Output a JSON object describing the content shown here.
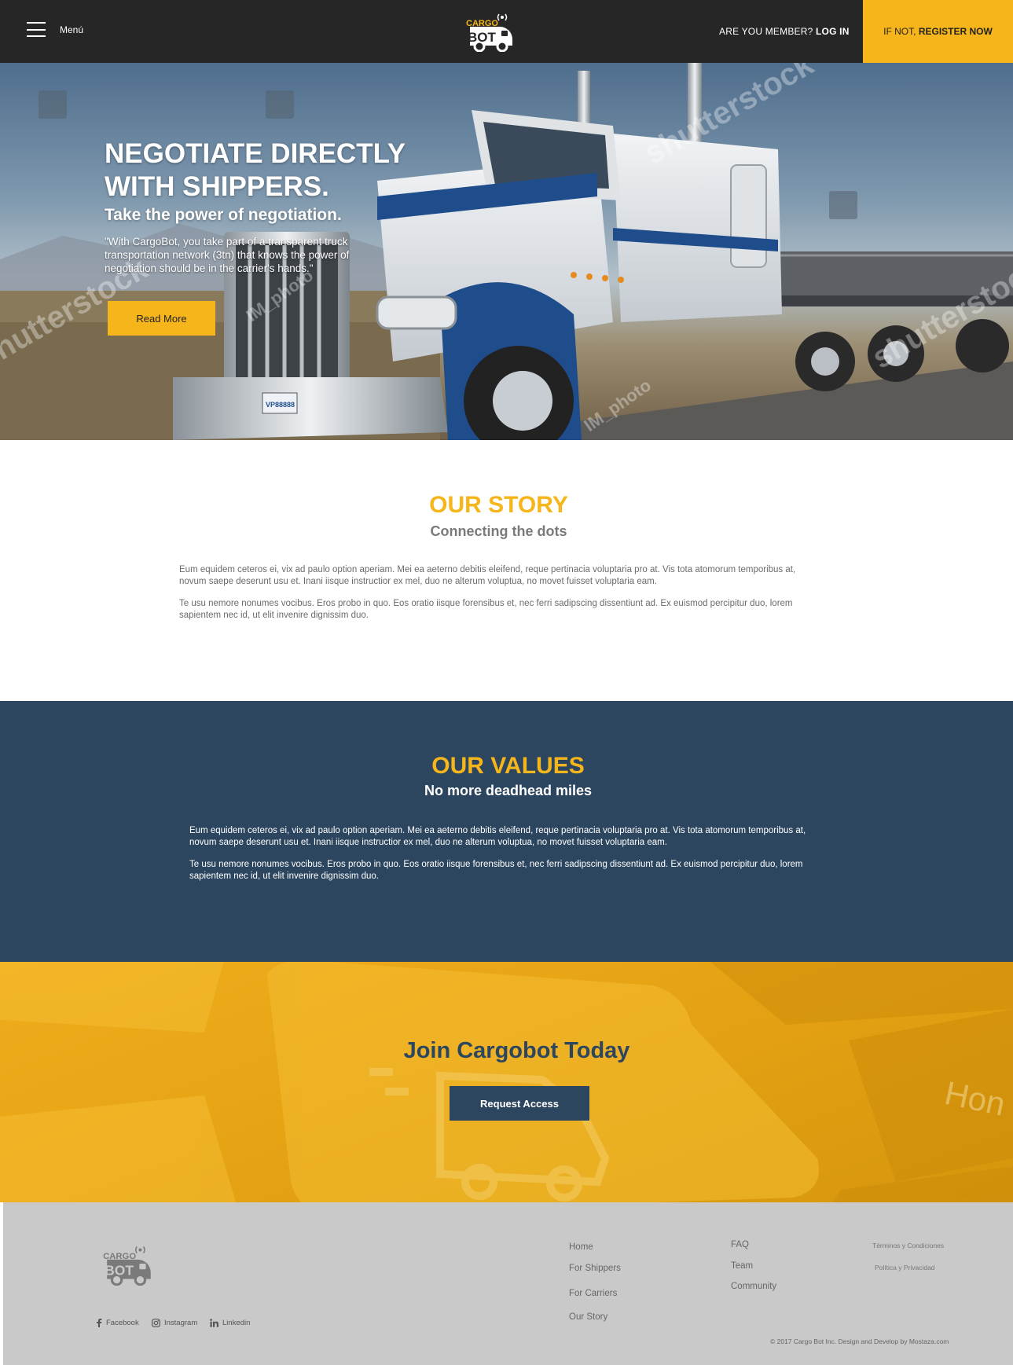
{
  "colors": {
    "accent": "#f6b51a",
    "navy": "#2d465f",
    "header_bg": "#262626",
    "footer_bg": "#c9c9c9"
  },
  "header": {
    "menu_icon": "hamburger-icon",
    "menu_label": "Menú",
    "logo": {
      "line1": "CARGO",
      "line2": "BOT"
    },
    "login_prefix": "ARE YOU MEMBER?",
    "login_label": "LOG IN",
    "register_prefix": "IF NOT,",
    "register_label": "REGISTER NOW"
  },
  "hero": {
    "title": "NEGOTIATE DIRECTLY WITH SHIPPERS.",
    "subtitle": "Take the power of negotiation.",
    "quote": "\"With CargoBot, you take part of a transparent truck transportation network (3tn) that knows the power of negotiation should be in the carrier's hands.\"",
    "button_label": "Read More",
    "plate": "VP88888",
    "watermarks": [
      "shutterstock",
      "IM_photo",
      "IM_photo",
      "shutterstock",
      "shutterstock"
    ]
  },
  "story": {
    "title": "OUR STORY",
    "subtitle": "Connecting the dots",
    "paragraphs": [
      "Eum equidem ceteros ei, vix ad paulo option aperiam. Mei ea aeterno debitis eleifend, reque pertinacia voluptaria pro at. Vis tota atomorum temporibus at, novum saepe deserunt usu et. Inani iisque instructior ex mel, duo ne alterum voluptua, no movet fuisset voluptaria eam.",
      "Te usu nemore nonumes vocibus. Eros probo in quo. Eos oratio iisque forensibus et, nec ferri sadipscing dissentiunt ad. Ex euismod percipitur duo, lorem sapientem nec id, ut elit invenire dignissim duo."
    ]
  },
  "values": {
    "title": "OUR VALUES",
    "subtitle": "No more deadhead miles",
    "paragraphs": [
      "Eum equidem ceteros ei, vix ad paulo option aperiam. Mei ea aeterno debitis eleifend, reque pertinacia voluptaria pro at. Vis tota atomorum temporibus at, novum saepe deserunt usu et. Inani iisque instructior ex mel, duo ne alterum voluptua, no movet fuisset voluptaria eam.",
      "Te usu nemore nonumes vocibus. Eros probo in quo. Eos oratio iisque forensibus et, nec ferri sadipscing dissentiunt ad. Ex euismod percipitur duo, lorem sapientem nec id, ut elit invenire dignissim duo."
    ]
  },
  "join": {
    "title": "Join Cargobot Today",
    "button_label": "Request Access",
    "key_text": "Hon"
  },
  "footer": {
    "logo": {
      "line1": "CARGO",
      "line2": "BOT"
    },
    "social": [
      {
        "label": "Facebook",
        "icon": "facebook-icon"
      },
      {
        "label": "Instagram",
        "icon": "instagram-icon"
      },
      {
        "label": "Linkedin",
        "icon": "linkedin-icon"
      }
    ],
    "col1": [
      "Home",
      "For Shippers",
      "For Carriers",
      "Our Story"
    ],
    "col2": [
      "FAQ",
      "Team",
      "Community"
    ],
    "legal": [
      "Términos y Condiciones",
      "Política y Privacidad"
    ],
    "copyright": "© 2017 Cargo Bot Inc. Design and Develop by Mostaza.com"
  }
}
